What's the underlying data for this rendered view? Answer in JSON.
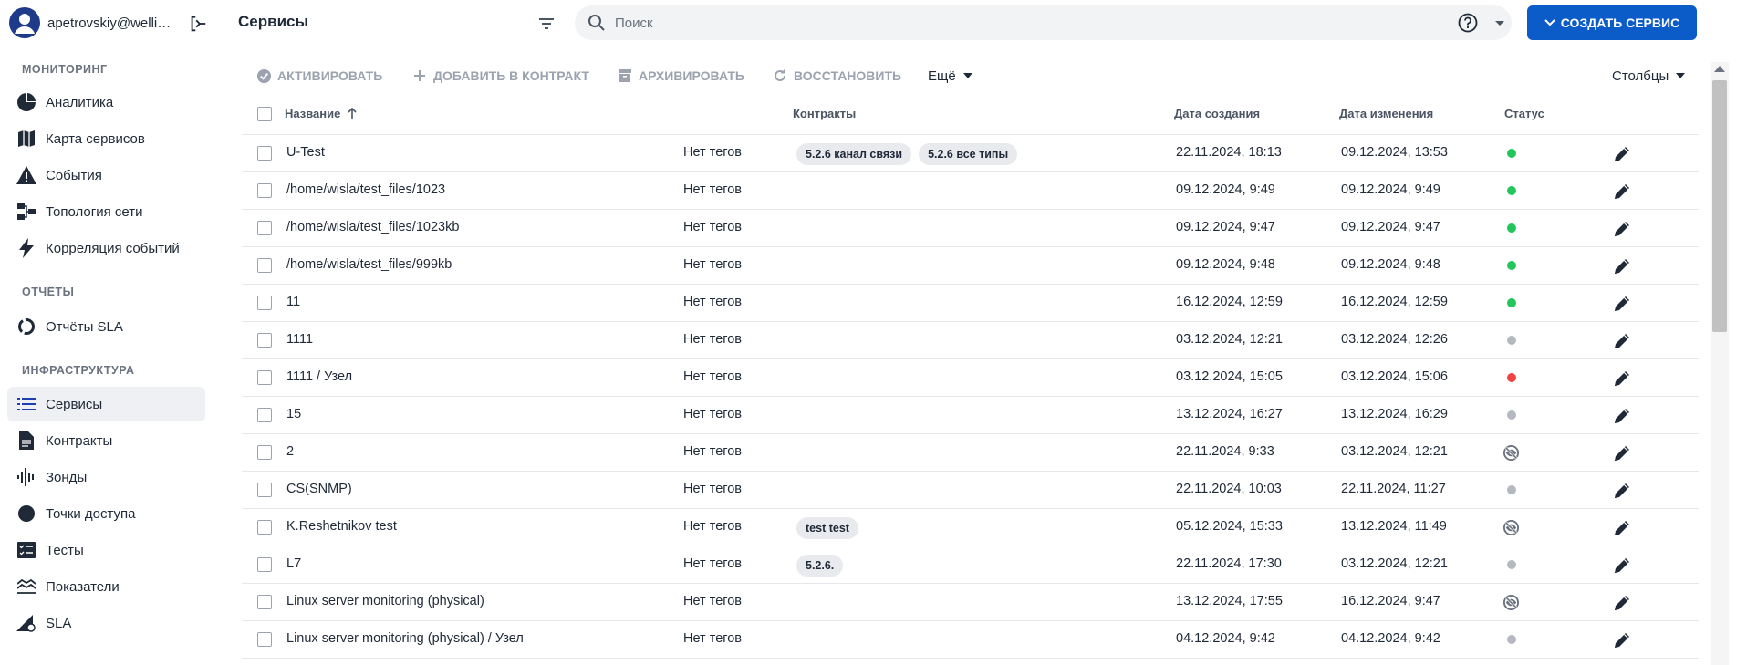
{
  "user": {
    "name": "apetrovskiy@wellin..."
  },
  "sidebar": {
    "sections": [
      {
        "title": "МОНИТОРИНГ"
      },
      {
        "title": "ОТЧЁТЫ"
      },
      {
        "title": "ИНФРАСТРУКТУРА"
      }
    ],
    "items": [
      {
        "label": "Аналитика",
        "icon": "pie-chart-icon"
      },
      {
        "label": "Карта сервисов",
        "icon": "map-icon"
      },
      {
        "label": "События",
        "icon": "warning-icon"
      },
      {
        "label": "Топология сети",
        "icon": "topology-icon"
      },
      {
        "label": "Корреляция событий",
        "icon": "bolt-icon"
      },
      {
        "label": "Отчёты SLA",
        "icon": "donut-icon"
      },
      {
        "label": "Сервисы",
        "icon": "list-icon",
        "active": true
      },
      {
        "label": "Контракты",
        "icon": "document-icon"
      },
      {
        "label": "Зонды",
        "icon": "waveform-icon"
      },
      {
        "label": "Точки доступа",
        "icon": "circle-icon"
      },
      {
        "label": "Тесты",
        "icon": "checklist-icon"
      },
      {
        "label": "Показатели",
        "icon": "metrics-icon"
      },
      {
        "label": "SLA",
        "icon": "sla-icon"
      }
    ]
  },
  "header": {
    "title": "Сервисы",
    "search_placeholder": "Поиск",
    "create_label": "СОЗДАТЬ СЕРВИС"
  },
  "toolbar": {
    "activate": "АКТИВИРОВАТЬ",
    "add_to_contract": "ДОБАВИТЬ В КОНТРАКТ",
    "archive": "АРХИВИРОВАТЬ",
    "restore": "ВОССТАНОВИТЬ",
    "more": "Ещё",
    "columns": "Столбцы"
  },
  "table": {
    "columns": {
      "name": "Название",
      "contracts": "Контракты",
      "created": "Дата создания",
      "modified": "Дата изменения",
      "status": "Статус"
    },
    "status_colors": {
      "green": "#22c55e",
      "gray": "#b5b9bf",
      "red": "#ef4444"
    },
    "rows": [
      {
        "name": "U-Test",
        "tags": "Нет тегов",
        "contracts": [
          "5.2.6 канал связи",
          "5.2.6 все типы"
        ],
        "created": "22.11.2024, 18:13",
        "modified": "09.12.2024, 13:53",
        "status": "green"
      },
      {
        "name": "/home/wisla/test_files/1023",
        "tags": "Нет тегов",
        "contracts": [],
        "created": "09.12.2024, 9:49",
        "modified": "09.12.2024, 9:49",
        "status": "green"
      },
      {
        "name": "/home/wisla/test_files/1023kb",
        "tags": "Нет тегов",
        "contracts": [],
        "created": "09.12.2024, 9:47",
        "modified": "09.12.2024, 9:47",
        "status": "green"
      },
      {
        "name": "/home/wisla/test_files/999kb",
        "tags": "Нет тегов",
        "contracts": [],
        "created": "09.12.2024, 9:48",
        "modified": "09.12.2024, 9:48",
        "status": "green"
      },
      {
        "name": "11",
        "tags": "Нет тегов",
        "contracts": [],
        "created": "16.12.2024, 12:59",
        "modified": "16.12.2024, 12:59",
        "status": "green"
      },
      {
        "name": "1111",
        "tags": "Нет тегов",
        "contracts": [],
        "created": "03.12.2024, 12:21",
        "modified": "03.12.2024, 12:26",
        "status": "gray"
      },
      {
        "name": "1111 / Узел",
        "tags": "Нет тегов",
        "contracts": [],
        "created": "03.12.2024, 15:05",
        "modified": "03.12.2024, 15:06",
        "status": "red"
      },
      {
        "name": "15",
        "tags": "Нет тегов",
        "contracts": [],
        "created": "13.12.2024, 16:27",
        "modified": "13.12.2024, 16:29",
        "status": "gray"
      },
      {
        "name": "2",
        "tags": "Нет тегов",
        "contracts": [],
        "created": "22.11.2024, 9:33",
        "modified": "03.12.2024, 12:21",
        "status": "hidden"
      },
      {
        "name": "CS(SNMP)",
        "tags": "Нет тегов",
        "contracts": [],
        "created": "22.11.2024, 10:03",
        "modified": "22.11.2024, 11:27",
        "status": "gray"
      },
      {
        "name": "K.Reshetnikov test",
        "tags": "Нет тегов",
        "contracts": [
          "test test"
        ],
        "created": "05.12.2024, 15:33",
        "modified": "13.12.2024, 11:49",
        "status": "hidden"
      },
      {
        "name": "L7",
        "tags": "Нет тегов",
        "contracts": [
          "5.2.6."
        ],
        "created": "22.11.2024, 17:30",
        "modified": "03.12.2024, 12:21",
        "status": "gray"
      },
      {
        "name": "Linux server monitoring (physical)",
        "tags": "Нет тегов",
        "contracts": [],
        "created": "13.12.2024, 17:55",
        "modified": "16.12.2024, 9:47",
        "status": "hidden"
      },
      {
        "name": "Linux server monitoring (physical) / Узел",
        "tags": "Нет тегов",
        "contracts": [],
        "created": "04.12.2024, 9:42",
        "modified": "04.12.2024, 9:42",
        "status": "gray"
      }
    ]
  },
  "colors": {
    "primary": "#0b5cc9",
    "text": "#1f2937",
    "muted": "#9ca3af"
  }
}
